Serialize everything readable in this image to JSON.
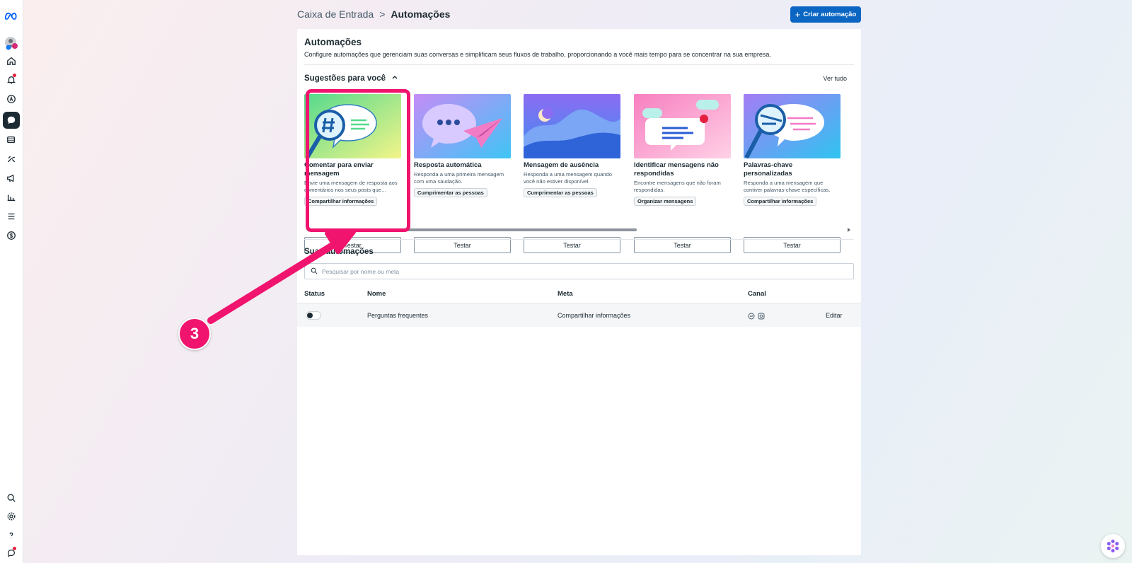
{
  "header": {
    "breadcrumb_root": "Caixa de Entrada",
    "breadcrumb_sep": ">",
    "breadcrumb_current": "Automações",
    "create_button": "Criar automação"
  },
  "intro": {
    "title": "Automações",
    "description": "Configure automações que gerenciam suas conversas e simplificam seus fluxos de trabalho, proporcionando a você mais tempo para se concentrar na sua empresa."
  },
  "suggestions": {
    "title": "Sugestões para você",
    "see_all": "Ver tudo",
    "cards": [
      {
        "title": "Comentar para enviar mensagem",
        "desc": "Envie uma mensagem de resposta aos comentários nos seus posts que…",
        "tag": "Compartilhar informações",
        "button": "Testar"
      },
      {
        "title": "Resposta automática",
        "desc": "Responda a uma primeira mensagem com uma saudação.",
        "tag": "Cumprimentar as pessoas",
        "button": "Testar"
      },
      {
        "title": "Mensagem de ausência",
        "desc": "Responda a uma mensagem quando você não estiver disponível.",
        "tag": "Cumprimentar as pessoas",
        "button": "Testar"
      },
      {
        "title": "Identificar mensagens não respondidas",
        "desc": "Encontre mensagens que não foram respondidas.",
        "tag": "Organizar mensagens",
        "button": "Testar"
      },
      {
        "title": "Palavras-chave personalizadas",
        "desc": "Responda a uma mensagem que contiver palavras-chave específicas.",
        "tag": "Compartilhar informações",
        "button": "Testar"
      }
    ]
  },
  "yours": {
    "title": "Suas automações",
    "search_placeholder": "Pesquisar por nome ou meta",
    "columns": {
      "status": "Status",
      "name": "Nome",
      "goal": "Meta",
      "channel": "Canal"
    },
    "rows": [
      {
        "name": "Perguntas frequentes",
        "goal": "Compartilhar informações",
        "action": "Editar",
        "status_on": false
      }
    ]
  },
  "annotation": {
    "step_number": "3",
    "color": "#f0146e"
  },
  "colors": {
    "primary": "#0a66c2",
    "text": "#1c2b33"
  }
}
